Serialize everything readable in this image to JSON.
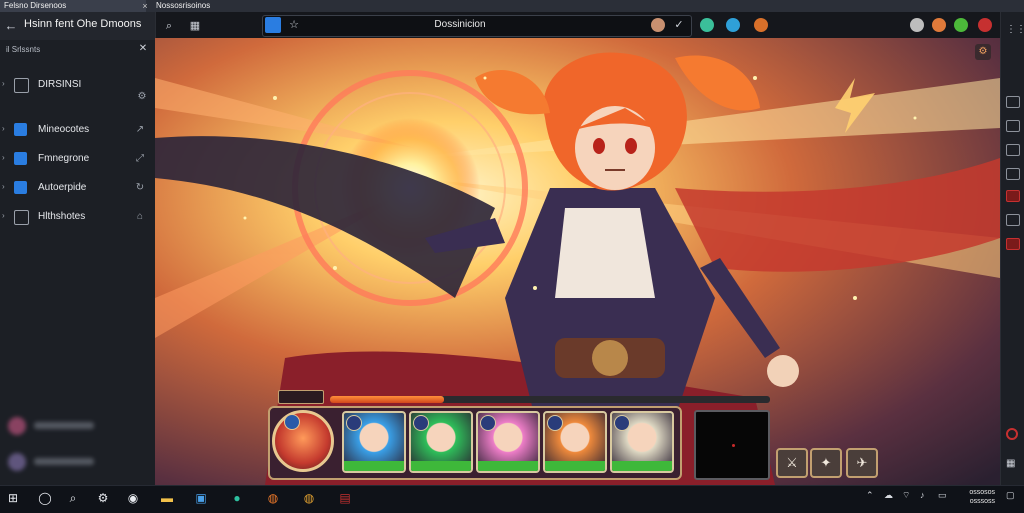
{
  "browser": {
    "tabs": [
      {
        "label": "Felsno Dirsenoos"
      },
      {
        "label": "Nossosrisoinos"
      }
    ],
    "tab_close": "×",
    "address_text": "Dossinicion"
  },
  "sidebar": {
    "title": "Hsinn fent Ohe Dmoons",
    "section_label": "il Srlssnts",
    "items": [
      {
        "label": "DIRSINSI",
        "icon_color": "#3a3f4b"
      },
      {
        "label": "Mineocotes",
        "icon_color": "#2a7de1"
      },
      {
        "label": "Fmnegrone",
        "icon_color": "#2a7de1"
      },
      {
        "label": "Autoerpide",
        "icon_color": "#2a7de1"
      },
      {
        "label": "Hlthshotes",
        "icon_color": "#3a3f4b"
      }
    ]
  },
  "game": {
    "hud": {
      "hp_fraction": 0.26,
      "party": [
        {
          "name": "Blue",
          "color": "#3aa0e8"
        },
        {
          "name": "Green",
          "color": "#2fbf5a"
        },
        {
          "name": "Pink",
          "color": "#ee7ec8"
        },
        {
          "name": "Orange",
          "color": "#ef8a3c"
        },
        {
          "name": "White",
          "color": "#ddd7c2"
        }
      ],
      "actions": [
        {
          "name": "sword",
          "glyph": "⚔"
        },
        {
          "name": "party",
          "glyph": "✦"
        },
        {
          "name": "wing",
          "glyph": "✈"
        }
      ]
    }
  },
  "taskbar": {
    "clock": "ossosos\nosssoss"
  },
  "colors": {
    "accent": "#2a7de1",
    "hp": "#d2471c",
    "sidebar_bg": "#1c1f25"
  }
}
